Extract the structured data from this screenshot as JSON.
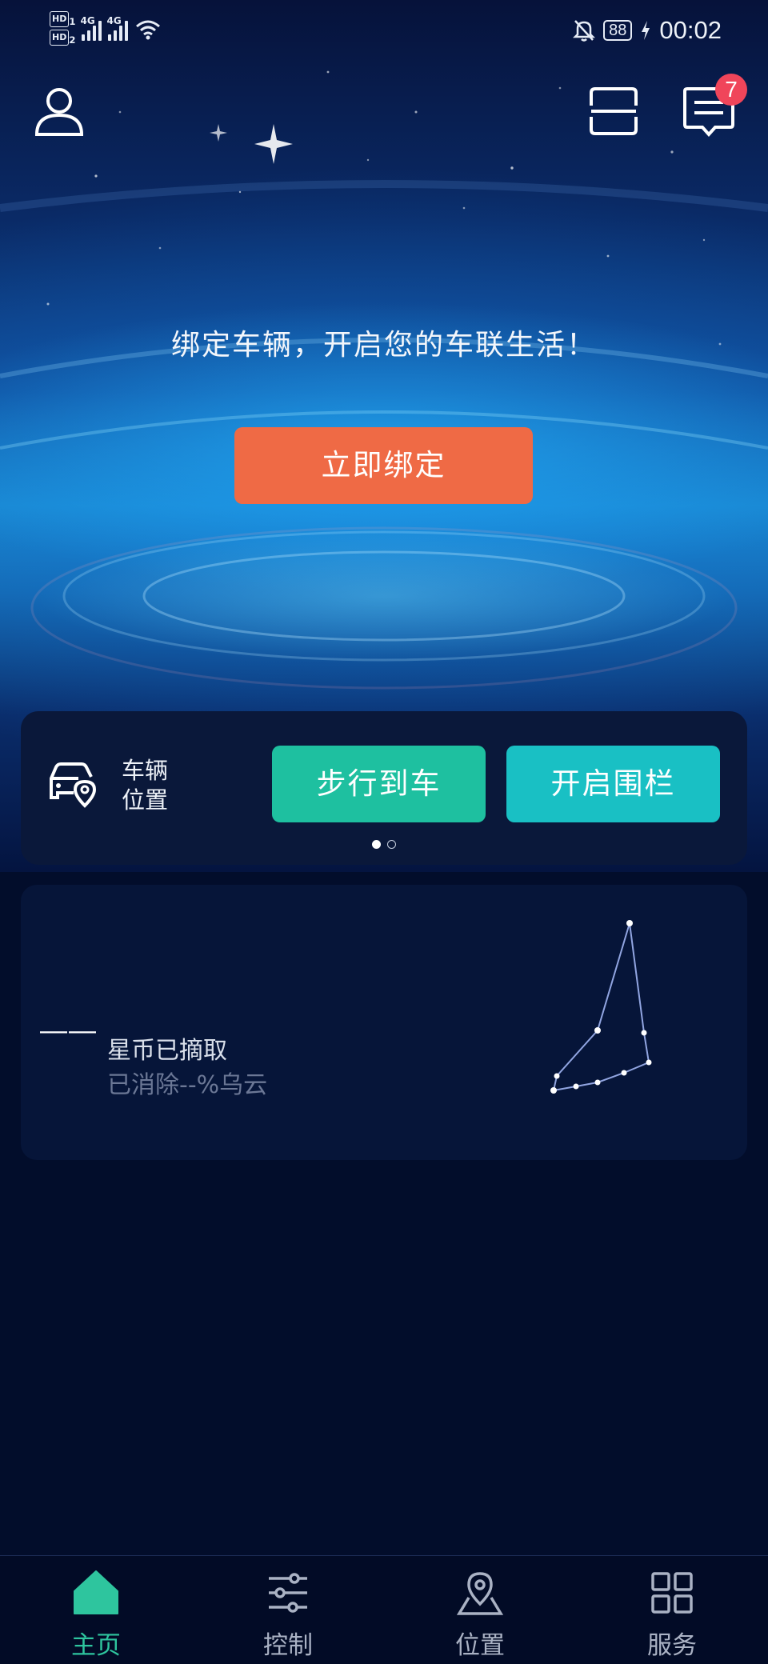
{
  "status_bar": {
    "hd1": "HD",
    "hd2": "HD",
    "hd1_sub": "1",
    "hd2_sub": "2",
    "net1": "4G",
    "net2": "4G",
    "battery": "88",
    "time": "00:02"
  },
  "header": {
    "notification_count": "7",
    "icons": [
      "profile-icon",
      "scan-icon",
      "message-icon"
    ]
  },
  "hero": {
    "tagline": "绑定车辆，开启您的车联生活！",
    "bind_button": "立即绑定"
  },
  "vehicle_card": {
    "label_line1": "车辆",
    "label_line2": "位置",
    "walk_button": "步行到车",
    "fence_button": "开启围栏",
    "page_count": 2,
    "active_page": 1
  },
  "star_card": {
    "value": "——",
    "coin_text": "星币已摘取",
    "cloud_text": "已消除--%乌云"
  },
  "nav": {
    "items": [
      {
        "label": "主页",
        "icon": "home-icon",
        "active": true
      },
      {
        "label": "控制",
        "icon": "sliders-icon",
        "active": false
      },
      {
        "label": "位置",
        "icon": "location-pin-icon",
        "active": false
      },
      {
        "label": "服务",
        "icon": "grid-icon",
        "active": false
      }
    ]
  },
  "colors": {
    "accent_orange": "#ef6a45",
    "accent_green": "#1ec0a0",
    "accent_teal": "#19c0c4",
    "nav_active": "#2ec59e",
    "badge_red": "#f0455a",
    "background": "#020d2b"
  }
}
